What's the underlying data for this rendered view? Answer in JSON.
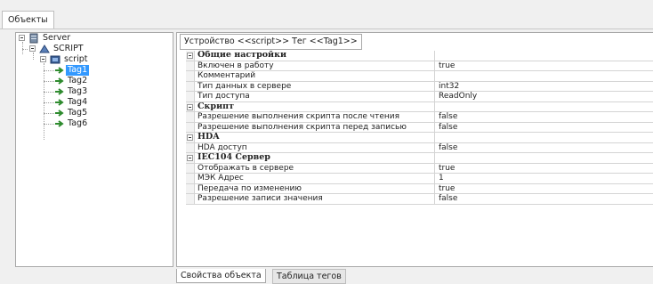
{
  "top_tab": {
    "label": "Объекты"
  },
  "tree": {
    "server": "Server",
    "script_group": "SCRIPT",
    "script_device": "script",
    "tags": [
      "Tag1",
      "Tag2",
      "Tag3",
      "Tag4",
      "Tag5",
      "Tag6"
    ],
    "selected": "Tag1",
    "colors": {
      "selection": "#3399ff",
      "tag_arrow": "#2e8b2e"
    }
  },
  "breadcrumb": "Устройство <<script>> Тег  <<Tag1>>",
  "properties": {
    "general": {
      "title": "Общие настройки",
      "rows": [
        {
          "name": "Включен в работу",
          "value": "true"
        },
        {
          "name": "Комментарий",
          "value": ""
        },
        {
          "name": "Тип данных в сервере",
          "value": "int32"
        },
        {
          "name": "Тип доступа",
          "value": "ReadOnly"
        }
      ]
    },
    "script": {
      "title": "Скрипт",
      "rows": [
        {
          "name": "Разрешение выполнения скрипта после чтения",
          "value": "false"
        },
        {
          "name": "Разрешение выполнения скрипта перед записью",
          "value": "false"
        }
      ]
    },
    "hda": {
      "title": "HDA",
      "rows": [
        {
          "name": "HDA доступ",
          "value": "false"
        }
      ]
    },
    "iec": {
      "title": "IEC104 Сервер",
      "rows": [
        {
          "name": "Отображать в сервере",
          "value": "true"
        },
        {
          "name": "МЭК Адрес",
          "value": "1"
        },
        {
          "name": "Передача по изменению",
          "value": "true"
        },
        {
          "name": "Разрешение записи значения",
          "value": "false"
        }
      ]
    }
  },
  "bottom_tabs": {
    "object_properties": "Свойства объекта",
    "tag_table": "Таблица тегов"
  }
}
